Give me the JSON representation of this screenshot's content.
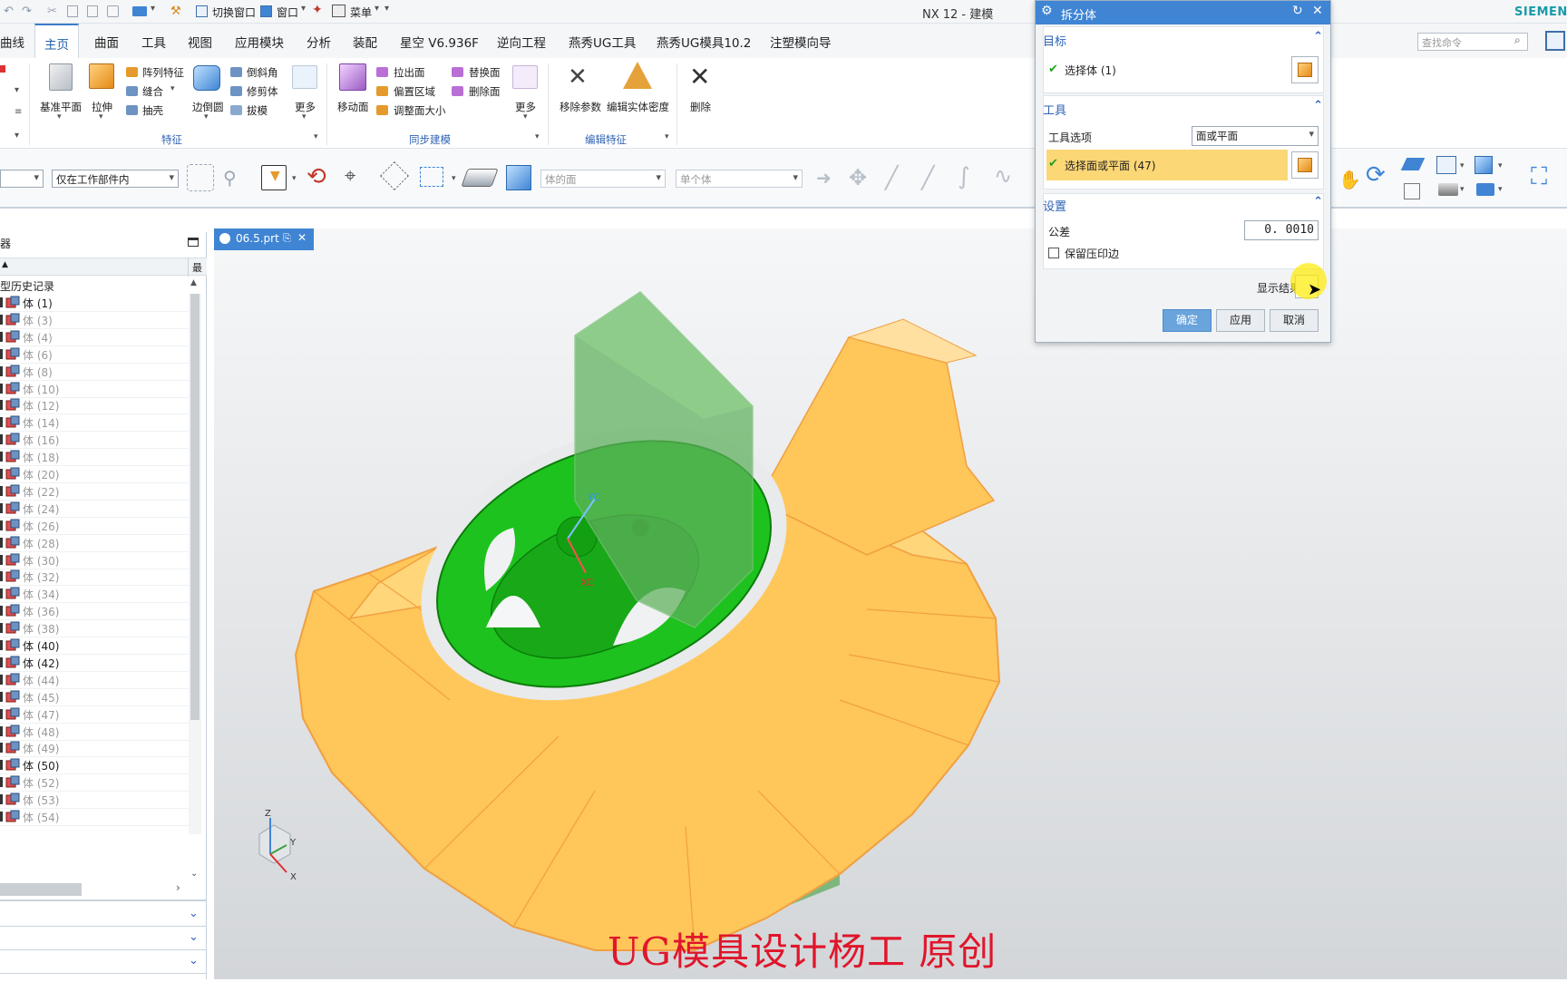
{
  "app": {
    "title": "NX 12 - 建模",
    "brand": "SIEMENS"
  },
  "quickbar": {
    "switch_window": "切换窗口",
    "window": "窗口",
    "menu": "菜单"
  },
  "menu_tabs": [
    "曲线",
    "主页",
    "曲面",
    "工具",
    "视图",
    "应用模块",
    "分析",
    "装配",
    "星空 V6.936F",
    "逆向工程",
    "燕秀UG工具",
    "燕秀UG模具10.2",
    "注塑模向导"
  ],
  "search": {
    "placeholder": "查找命令"
  },
  "ribbon": {
    "features": {
      "datum_plane": "基准平面",
      "extrude": "拉伸",
      "pattern_feature": "阵列特征",
      "sew": "缝合",
      "shell": "抽壳",
      "edge_blend": "边倒圆",
      "chamfer": "倒斜角",
      "trim_body": "修剪体",
      "draft": "拔模",
      "more": "更多",
      "group": "特征"
    },
    "sync": {
      "move_face": "移动面",
      "pull_face": "拉出面",
      "offset_region": "偏置区域",
      "resize_face": "调整面大小",
      "replace_face": "替换面",
      "delete_face": "删除面",
      "more": "更多",
      "group": "同步建模"
    },
    "edit": {
      "remove_params": "移除参数",
      "edit_density": "编辑实体密度",
      "group": "编辑特征"
    },
    "delete": "删除"
  },
  "selbar": {
    "scope": "仅在工作部件内",
    "face_rule": "体的面",
    "body_rule": "单个体"
  },
  "navigator": {
    "title": "部件导航器",
    "title_visible": "器",
    "history": "型历史记录",
    "col_flag": "最",
    "rows": [
      {
        "label": "体 (1)",
        "gray": false
      },
      {
        "label": "体 (3)",
        "gray": true
      },
      {
        "label": "体 (4)",
        "gray": true
      },
      {
        "label": "体 (6)",
        "gray": true
      },
      {
        "label": "体 (8)",
        "gray": true
      },
      {
        "label": "体 (10)",
        "gray": true
      },
      {
        "label": "体 (12)",
        "gray": true
      },
      {
        "label": "体 (14)",
        "gray": true
      },
      {
        "label": "体 (16)",
        "gray": true
      },
      {
        "label": "体 (18)",
        "gray": true
      },
      {
        "label": "体 (20)",
        "gray": true
      },
      {
        "label": "体 (22)",
        "gray": true
      },
      {
        "label": "体 (24)",
        "gray": true
      },
      {
        "label": "体 (26)",
        "gray": true
      },
      {
        "label": "体 (28)",
        "gray": true
      },
      {
        "label": "体 (30)",
        "gray": true
      },
      {
        "label": "体 (32)",
        "gray": true
      },
      {
        "label": "体 (34)",
        "gray": true
      },
      {
        "label": "体 (36)",
        "gray": true
      },
      {
        "label": "体 (38)",
        "gray": true
      },
      {
        "label": "体 (40)",
        "gray": false
      },
      {
        "label": "体 (42)",
        "gray": false
      },
      {
        "label": "体 (44)",
        "gray": true
      },
      {
        "label": "体 (45)",
        "gray": true
      },
      {
        "label": "体 (47)",
        "gray": true
      },
      {
        "label": "体 (48)",
        "gray": true
      },
      {
        "label": "体 (49)",
        "gray": true
      },
      {
        "label": "体 (50)",
        "gray": false
      },
      {
        "label": "体 (52)",
        "gray": true
      },
      {
        "label": "体 (53)",
        "gray": true
      },
      {
        "label": "体 (54)",
        "gray": true
      }
    ]
  },
  "doc_tab": "06.5.prt",
  "dialog": {
    "title": "拆分体",
    "target": {
      "header": "目标",
      "select_body": "选择体 (1)"
    },
    "tool": {
      "header": "工具",
      "option_label": "工具选项",
      "option_value": "面或平面",
      "select_face": "选择面或平面 (47)"
    },
    "settings": {
      "header": "设置",
      "tolerance_label": "公差",
      "tolerance_value": "0. 0010",
      "keep_imprint": "保留压印边"
    },
    "show_result": "显示结果",
    "ok": "确定",
    "apply": "应用",
    "cancel": "取消"
  },
  "axes": {
    "x": "X",
    "y": "Y",
    "z": "Z",
    "xc": "XC",
    "yc": "YC"
  },
  "watermark": "UG模具设计杨工 原创",
  "colors": {
    "accent": "#3f85d4",
    "orange_body": "#ffc65a",
    "green_body": "#1ec21e",
    "highlight": "#fcd775",
    "watermark": "#e0162b"
  }
}
